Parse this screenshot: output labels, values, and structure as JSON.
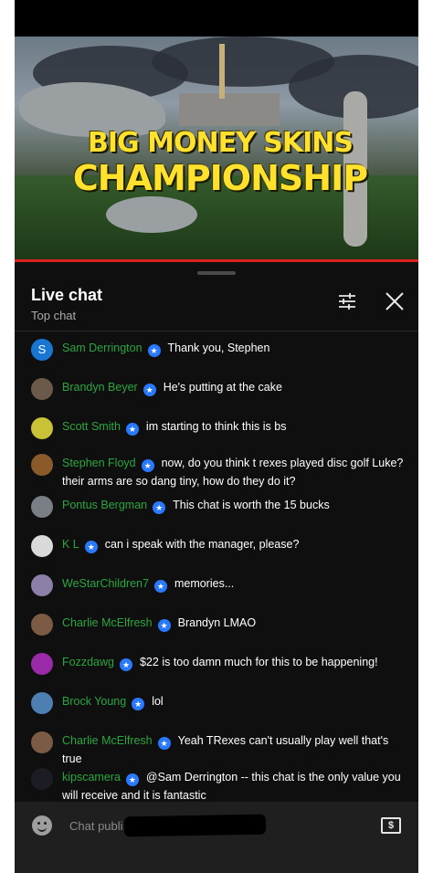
{
  "video": {
    "title_line1": "BIG MONEY SKINS",
    "title_line2": "CHAMPIONSHIP"
  },
  "header": {
    "title": "Live chat",
    "subtitle": "Top chat"
  },
  "messages": [
    {
      "author": "Sam Derrington",
      "text": "Thank you, Stephen",
      "avatar_letter": "S",
      "avatar_color": "#1976d2"
    },
    {
      "author": "Brandyn Beyer",
      "text": "He's putting at the cake",
      "avatar_letter": "",
      "avatar_color": "#6b5a4a"
    },
    {
      "author": "Scott Smith",
      "text": "im starting to think this is bs",
      "avatar_letter": "",
      "avatar_color": "#c9c236"
    },
    {
      "author": "Stephen Floyd",
      "text": "now, do you think t rexes played disc golf Luke? their arms are so dang tiny, how do they do it?",
      "avatar_letter": "",
      "avatar_color": "#8a5a2b"
    },
    {
      "author": "Pontus Bergman",
      "text": "This chat is worth the 15 bucks",
      "avatar_letter": "",
      "avatar_color": "#7a7f86"
    },
    {
      "author": "K L",
      "text": "can i speak with the manager, please?",
      "avatar_letter": "",
      "avatar_color": "#d9d9d9"
    },
    {
      "author": "WeStarChildren7",
      "text": "memories...",
      "avatar_letter": "",
      "avatar_color": "#8c7fa8"
    },
    {
      "author": "Charlie McElfresh",
      "text": "Brandyn LMAO",
      "avatar_letter": "",
      "avatar_color": "#7c5b45"
    },
    {
      "author": "Fozzdawg",
      "text": "$22 is too damn much for this to be happening!",
      "avatar_letter": "",
      "avatar_color": "#9b2aa8"
    },
    {
      "author": "Brock Young",
      "text": "lol",
      "avatar_letter": "",
      "avatar_color": "#4d7fb3"
    },
    {
      "author": "Charlie McElfresh",
      "text": "Yeah TRexes can't usually play well that's true",
      "avatar_letter": "",
      "avatar_color": "#7c5b45"
    },
    {
      "author": "kipscamera",
      "text": "@Sam Derrington -- this chat is the only value you will receive and it is fantastic",
      "avatar_letter": "",
      "avatar_color": "#1c1c24"
    }
  ],
  "input": {
    "placeholder": "Chat publi"
  },
  "colors": {
    "author": "#2ba640",
    "badge": "#2979ff",
    "progress": "#e02020",
    "title_yellow": "#ffe12e"
  },
  "icons": {
    "filter": "filter-sliders-icon",
    "close": "close-icon",
    "emoji": "emoji-icon",
    "superchat": "dollar-icon",
    "member_badge": "member-star-icon"
  }
}
